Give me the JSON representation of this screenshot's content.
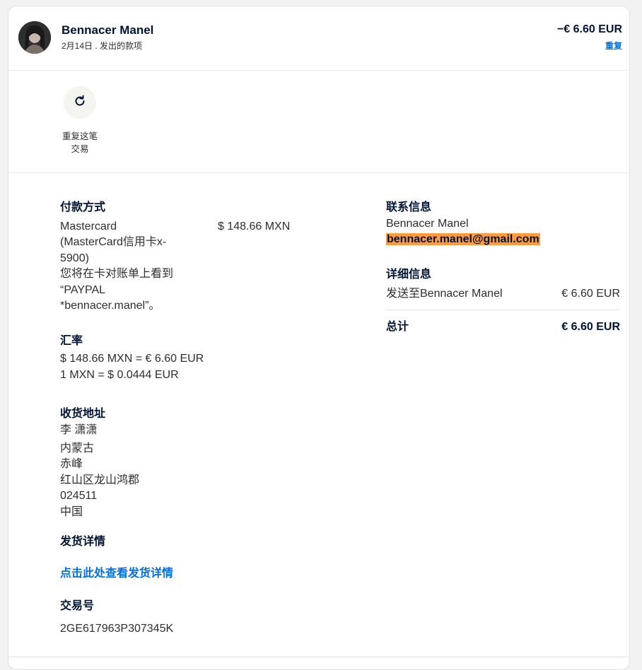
{
  "header": {
    "name": "Bennacer Manel",
    "subline": "2月14日 . 发出的款项",
    "amount": "−€ 6.60 EUR",
    "status": "重复"
  },
  "actions": {
    "repeat_label": "重复这笔\n交易",
    "repeat_icon": "refresh-icon"
  },
  "payment": {
    "title": "付款方式",
    "method_lines": [
      "Mastercard",
      "(MasterCard信用卡x-",
      "5900)",
      "您将在卡对账单上看到",
      "“PAYPAL",
      "*bennacer.manel”。"
    ],
    "amount": "$ 148.66 MXN"
  },
  "exchange": {
    "title": "汇率",
    "line1": "$ 148.66 MXN = € 6.60 EUR",
    "line2": "1 MXN = $ 0.0444 EUR"
  },
  "shipping_address": {
    "title": "收货地址",
    "lines": [
      "李 潇潇",
      "内蒙古",
      "赤峰",
      "红山区龙山鸿郡",
      "024511",
      "中国"
    ]
  },
  "shipping_details": {
    "title": "发货详情",
    "link": "点击此处查看发货详情"
  },
  "transaction": {
    "title": "交易号",
    "id": "2GE617963P307345K"
  },
  "contact": {
    "title": "联系信息",
    "name": "Bennacer Manel",
    "email": "bennacer.manel@gmail.com"
  },
  "details": {
    "title": "详细信息",
    "sent_to_label": "发送至Bennacer Manel",
    "sent_to_amount": "€ 6.60 EUR",
    "total_label": "总计",
    "total_amount": "€ 6.60 EUR"
  },
  "colors": {
    "link": "#0070e0",
    "highlight": "#ff9b3d",
    "heading": "#001435"
  }
}
